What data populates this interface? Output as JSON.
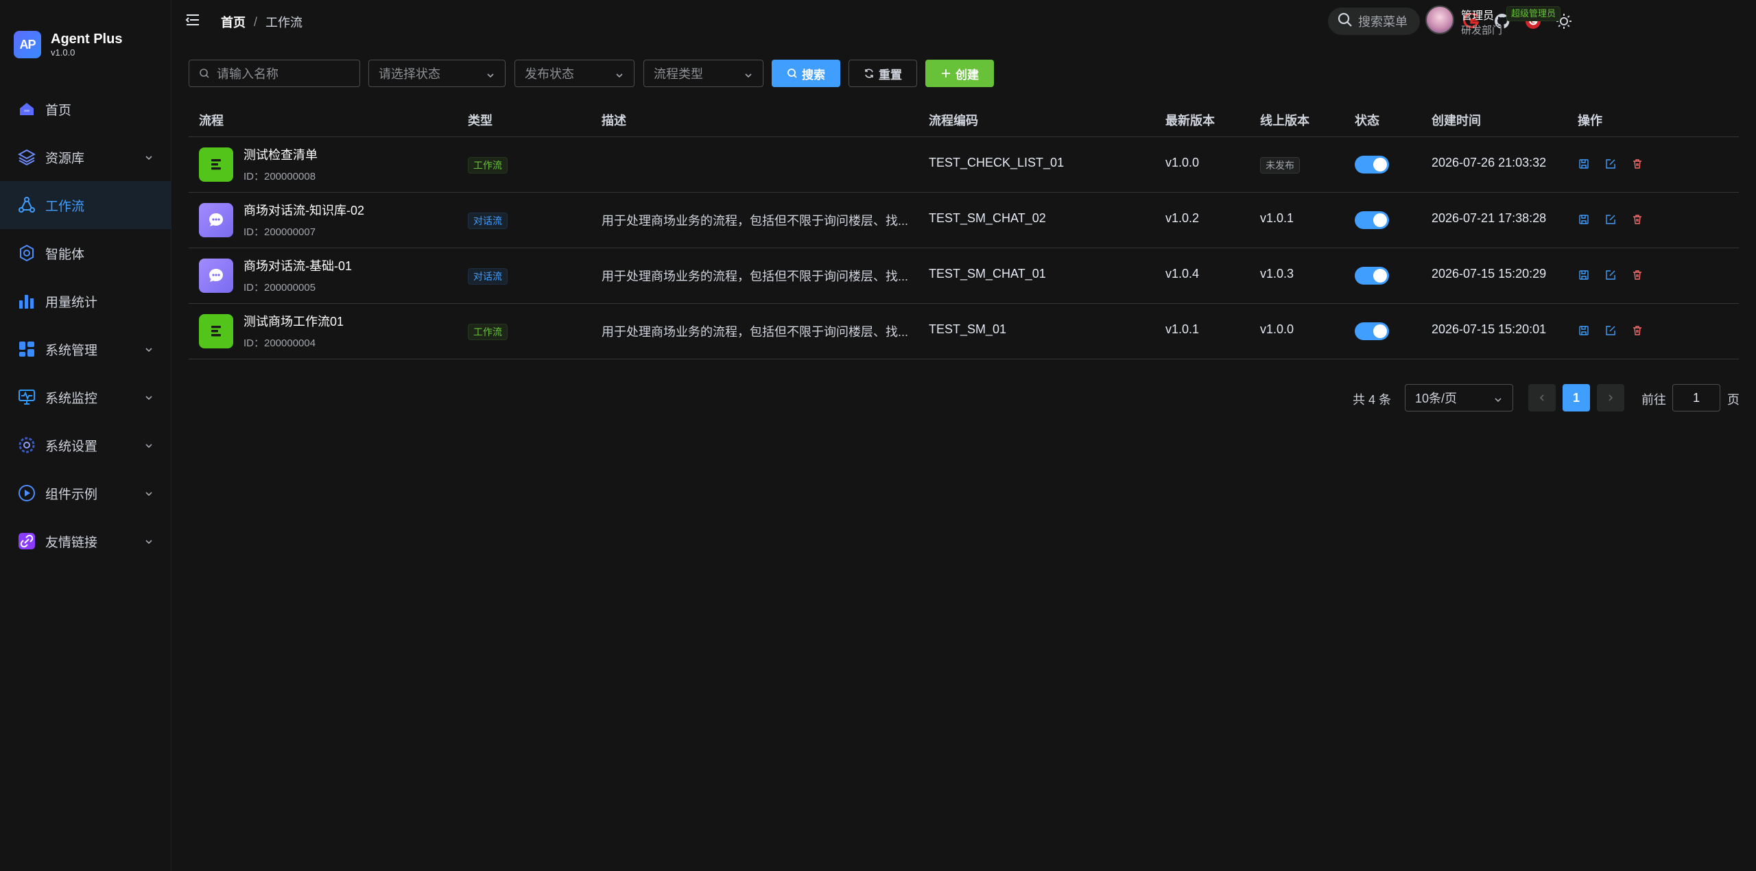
{
  "app": {
    "name": "Agent Plus",
    "version": "v1.0.0",
    "logo_text": "AP"
  },
  "sidebar": {
    "items": [
      {
        "label": "首页",
        "icon": "home-icon",
        "active": false,
        "expandable": false
      },
      {
        "label": "资源库",
        "icon": "layers-icon",
        "active": false,
        "expandable": true
      },
      {
        "label": "工作流",
        "icon": "workflow-icon",
        "active": true,
        "expandable": false
      },
      {
        "label": "智能体",
        "icon": "agent-icon",
        "active": false,
        "expandable": false
      },
      {
        "label": "用量统计",
        "icon": "bar-chart-icon",
        "active": false,
        "expandable": false
      },
      {
        "label": "系统管理",
        "icon": "grid-icon",
        "active": false,
        "expandable": true
      },
      {
        "label": "系统监控",
        "icon": "monitor-icon",
        "active": false,
        "expandable": true
      },
      {
        "label": "系统设置",
        "icon": "gear-icon",
        "active": false,
        "expandable": true
      },
      {
        "label": "组件示例",
        "icon": "play-icon",
        "active": false,
        "expandable": true
      },
      {
        "label": "友情链接",
        "icon": "link-icon",
        "active": false,
        "expandable": true
      }
    ]
  },
  "header": {
    "breadcrumb": {
      "home": "首页",
      "separator": "/",
      "current": "工作流"
    },
    "search_label": "搜索菜单",
    "user": {
      "name": "管理员",
      "role": "超级管理员",
      "dept": "研发部门"
    }
  },
  "filters": {
    "name_placeholder": "请输入名称",
    "status_placeholder": "请选择状态",
    "publish_placeholder": "发布状态",
    "type_placeholder": "流程类型",
    "search_label": "搜索",
    "reset_label": "重置",
    "create_label": "创建"
  },
  "table": {
    "columns": {
      "flow": "流程",
      "type": "类型",
      "desc": "描述",
      "code": "流程编码",
      "latest": "最新版本",
      "online": "线上版本",
      "status": "状态",
      "created": "创建时间",
      "ops": "操作"
    },
    "rows": [
      {
        "name": "测试检查清单",
        "id": "ID：200000008",
        "kind": "workflow",
        "type": "工作流",
        "desc": "",
        "code": "TEST_CHECK_LIST_01",
        "latest": "v1.0.0",
        "online": "未发布",
        "online_published": false,
        "enabled": true,
        "created": "2026-07-26 21:03:32"
      },
      {
        "name": "商场对话流-知识库-02",
        "id": "ID：200000007",
        "kind": "chat",
        "type": "对话流",
        "desc": "用于处理商场业务的流程，包括但不限于询问楼层、找...",
        "code": "TEST_SM_CHAT_02",
        "latest": "v1.0.2",
        "online": "v1.0.1",
        "online_published": true,
        "enabled": true,
        "created": "2026-07-21 17:38:28"
      },
      {
        "name": "商场对话流-基础-01",
        "id": "ID：200000005",
        "kind": "chat",
        "type": "对话流",
        "desc": "用于处理商场业务的流程，包括但不限于询问楼层、找...",
        "code": "TEST_SM_CHAT_01",
        "latest": "v1.0.4",
        "online": "v1.0.3",
        "online_published": true,
        "enabled": true,
        "created": "2026-07-15 15:20:29"
      },
      {
        "name": "测试商场工作流01",
        "id": "ID：200000004",
        "kind": "workflow",
        "type": "工作流",
        "desc": "用于处理商场业务的流程，包括但不限于询问楼层、找...",
        "code": "TEST_SM_01",
        "latest": "v1.0.1",
        "online": "v1.0.0",
        "online_published": true,
        "enabled": true,
        "created": "2026-07-15 15:20:01"
      }
    ]
  },
  "pagination": {
    "total_text": "共 4 条",
    "page_size": "10条/页",
    "current_page": "1",
    "goto_label": "前往",
    "goto_value": "1",
    "page_suffix": "页"
  },
  "colors": {
    "primary": "#409eff",
    "success": "#67c23a",
    "danger": "#f56c6c",
    "background": "#141414"
  }
}
